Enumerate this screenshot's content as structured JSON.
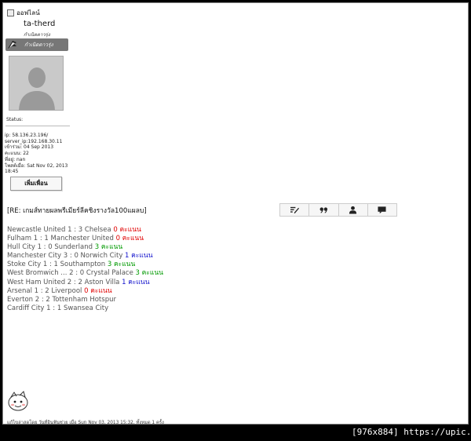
{
  "sidebar": {
    "offline_label": "ออฟไลน์",
    "username": "ta-therd",
    "rank_subtitle": "กำเนิดดาวรุ่ง",
    "rank_badge": "กำเนิดดาวรุ่ง",
    "status_label": "Status:",
    "info": {
      "ip": "ip: 58.136.23.196/",
      "server_ip": "server_ip:192.168.30.11",
      "joined": "เข้าร่วม: 04 Sep 2013",
      "score": "คะแนน: 22",
      "location": "ที่อยู่: nan",
      "posted": "โพสต์เมื่อ: Sat Nov 02, 2013",
      "posted_time": "18:45"
    },
    "add_friend_label": "เพิ่มเพื่อน"
  },
  "post": {
    "title": "[RE: เกมส์ทายผลพรีเมียร์ลีคชิงรางวัล100แผลบ]",
    "lines": [
      {
        "match": "Newcastle United 1 : 3 Chelsea",
        "points": "0 คะแนน",
        "color": "#e00000"
      },
      {
        "match": "Fulham 1 : 1 Manchester United",
        "points": "0 คะแนน",
        "color": "#e00000"
      },
      {
        "match": "Hull City 1 : 0 Sunderland",
        "points": "3 คะแนน",
        "color": "#009a00"
      },
      {
        "match": "Manchester City 3 : 0 Norwich City",
        "points": "1 คะแนน",
        "color": "#1010cc"
      },
      {
        "match": "Stoke City 1 : 1 Southampton",
        "points": "3 คะแนน",
        "color": "#009a00"
      },
      {
        "match": "West Bromwich ... 2 : 0 Crystal Palace",
        "points": "3 คะแนน",
        "color": "#009a00"
      },
      {
        "match": "West Ham United 2 : 2 Aston Villa",
        "points": "1 คะแนน",
        "color": "#1010cc"
      },
      {
        "match": "Arsenal 1 : 2 Liverpool",
        "points": "0 คะแนน",
        "color": "#e00000"
      },
      {
        "match": "Everton 2 : 2 Tottenham Hotspur",
        "points": "",
        "color": ""
      },
      {
        "match": "Cardiff City 1 : 1 Swansea City",
        "points": "",
        "color": ""
      }
    ],
    "edit_note": "แก้ไขล่าสุดโดย วันที่อินฟันช่วย เมื่อ Sun Nov 03, 2013 15:32, ทั้งหมด 1 ครั้ง"
  },
  "toolbar": {
    "icons": [
      "edit-icon",
      "quote-icon",
      "profile-icon",
      "message-icon"
    ]
  },
  "watermark": "[976x884] https://upic.me/"
}
